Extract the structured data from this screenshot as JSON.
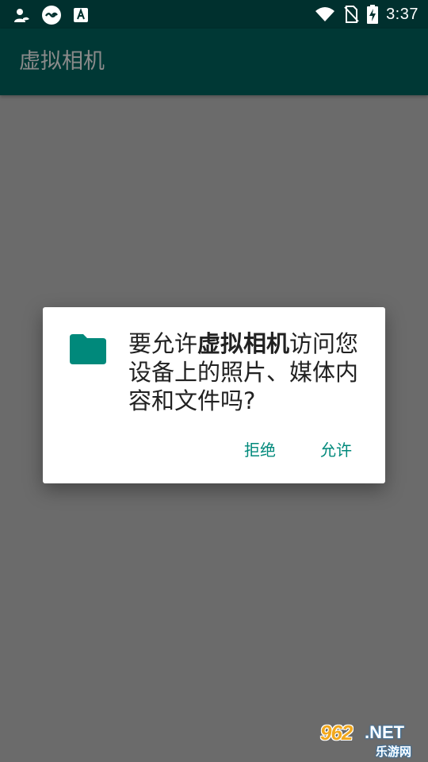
{
  "status_bar": {
    "time": "3:37",
    "left_icons": [
      "weather-person-icon",
      "game-controller-icon",
      "font-a-icon"
    ],
    "right_icons": [
      "wifi-icon",
      "no-sim-icon",
      "battery-charging-icon"
    ]
  },
  "app_bar": {
    "title": "虚拟相机"
  },
  "dialog": {
    "icon": "folder-icon",
    "message_prefix": "要允许",
    "app_name": "虚拟相机",
    "message_suffix": "访问您设备上的照片、媒体内容和文件吗?",
    "deny_label": "拒绝",
    "allow_label": "允许"
  },
  "watermark": {
    "number": "962",
    "net": ".NET",
    "subtitle": "乐游网"
  },
  "colors": {
    "status_bar_bg": "#00302e",
    "app_bar_bg": "#003835",
    "scrim": "#6b6b6b",
    "accent": "#00897b",
    "folder_icon": "#00897b"
  }
}
